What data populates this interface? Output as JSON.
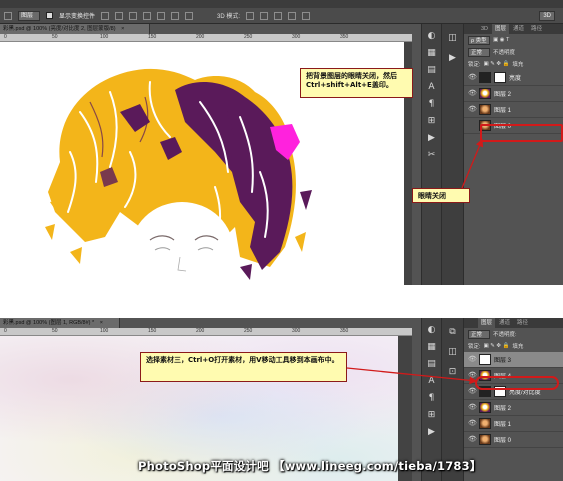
{
  "top": {
    "option_bar": {
      "layer_select": "图层",
      "show_transform_label": "显示变换控件",
      "mode_3d_label": "3D 模式:",
      "workspace_badge": "3D"
    },
    "doc_tab": "彩黑.psd @ 100% (亮度/对比度 2, 图层蒙版/8)",
    "ruler_ticks": [
      "0",
      "50",
      "100",
      "150",
      "200",
      "250",
      "300",
      "350"
    ],
    "layers_panel": {
      "tabs": [
        "3D",
        "图层",
        "通道",
        "路径"
      ],
      "filter_label": "ρ 类型",
      "blend_mode": "正常",
      "opacity_label": "不透明度",
      "lock_label": "锁定:",
      "fill_label": "填充",
      "layers": [
        {
          "name": "亮度",
          "thumb": "white",
          "visible": true,
          "selected": false
        },
        {
          "name": "图层 2",
          "thumb": "colorface",
          "visible": true,
          "selected": false
        },
        {
          "name": "图层 1",
          "thumb": "face",
          "visible": true,
          "selected": false
        },
        {
          "name": "图层 0",
          "thumb": "face",
          "visible": false,
          "selected": false
        }
      ]
    },
    "callout_main": "把背景图层的眼睛关闭，然后Ctrl+shift+Alt+E盖印。",
    "callout_eye": "眼睛关闭"
  },
  "bottom": {
    "doc_tab": "彩黑.psd @ 100% (图层 1, RGB/8#) *",
    "ruler_ticks": [
      "0",
      "50",
      "100",
      "150",
      "200",
      "250",
      "300",
      "350"
    ],
    "layers_panel": {
      "tabs": [
        "图层",
        "通道",
        "路径"
      ],
      "blend_mode": "正常",
      "opacity_label": "不透明度:",
      "lock_label": "锁定:",
      "fill_label": "填充",
      "layers": [
        {
          "name": "图层 3",
          "thumb": "white",
          "visible": true,
          "selected": true
        },
        {
          "name": "图层 4",
          "thumb": "colorface",
          "visible": true,
          "selected": false
        },
        {
          "name": "亮度/对比度",
          "thumb": "white",
          "visible": true,
          "selected": false
        },
        {
          "name": "图层 2",
          "thumb": "colorface",
          "visible": true,
          "selected": false
        },
        {
          "name": "图层 1",
          "thumb": "face",
          "visible": true,
          "selected": false
        },
        {
          "name": "图层 0",
          "thumb": "face",
          "visible": true,
          "selected": false
        }
      ]
    },
    "callout_main": "选择素材三，Ctrl+O打开素材，用V移动工具移到本画布中。"
  },
  "watermark": "PhotoShop平面设计吧 【www.lineeg.com/tieba/1783】",
  "colors": {
    "ui_bg": "#535353",
    "callout_bg": "#fffbb0",
    "callout_border": "#8b1a1a",
    "highlight_red": "#d11a1a",
    "hair_yellow": "#f3b51a",
    "hair_purple": "#5a1a5a",
    "hair_magenta": "#ff22dd"
  }
}
